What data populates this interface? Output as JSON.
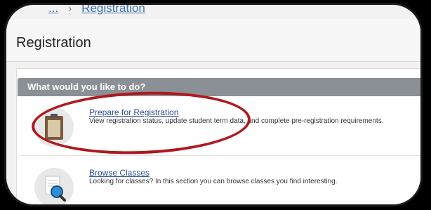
{
  "breadcrumb": {
    "items": [
      "...",
      "Registration"
    ]
  },
  "page": {
    "title": "Registration"
  },
  "section": {
    "header": "What would you like to do?"
  },
  "items": [
    {
      "title": "Prepare for Registration",
      "description": "View registration status, update student term data, and complete pre-registration requirements.",
      "icon": "clipboard-icon"
    },
    {
      "title": "Browse Classes",
      "description": "Looking for classes? In this section you can browse classes you find interesting.",
      "icon": "magnifier-document-icon"
    }
  ],
  "colors": {
    "highlight": "#b0181f",
    "link": "#2a4f9c",
    "section_header_bg": "#8a9096"
  }
}
